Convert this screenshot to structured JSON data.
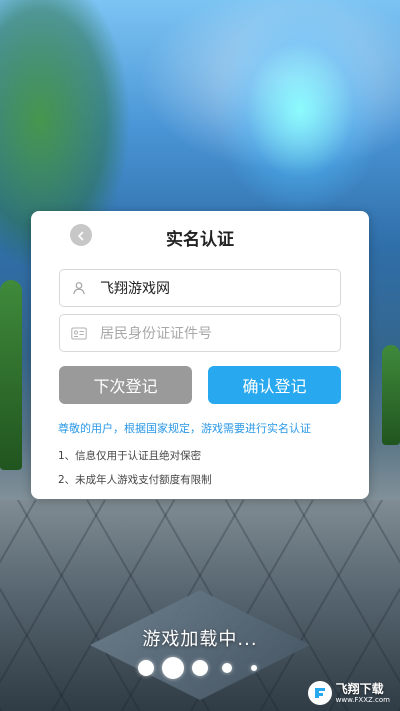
{
  "dialog": {
    "title": "实名认证",
    "name_field": {
      "value": "飞翔游戏网",
      "icon": "user-icon"
    },
    "id_field": {
      "placeholder": "居民身份证证件号",
      "icon": "id-card-icon"
    },
    "buttons": {
      "later": "下次登记",
      "confirm": "确认登记"
    },
    "notice": "尊敬的用户，根据国家规定，游戏需要进行实名认证",
    "rules": [
      "1、信息仅用于认证且绝对保密",
      "2、未成年人游戏支付额度有限制"
    ]
  },
  "loading": {
    "text": "游戏加载中...",
    "page_count": 5,
    "active_index": 1
  },
  "watermark": {
    "title": "飞翔下载",
    "url": "www.FXXZ.com"
  },
  "colors": {
    "primary": "#27a8ef",
    "secondary_button": "#9a9a9a",
    "notice_text": "#2a98e6"
  }
}
